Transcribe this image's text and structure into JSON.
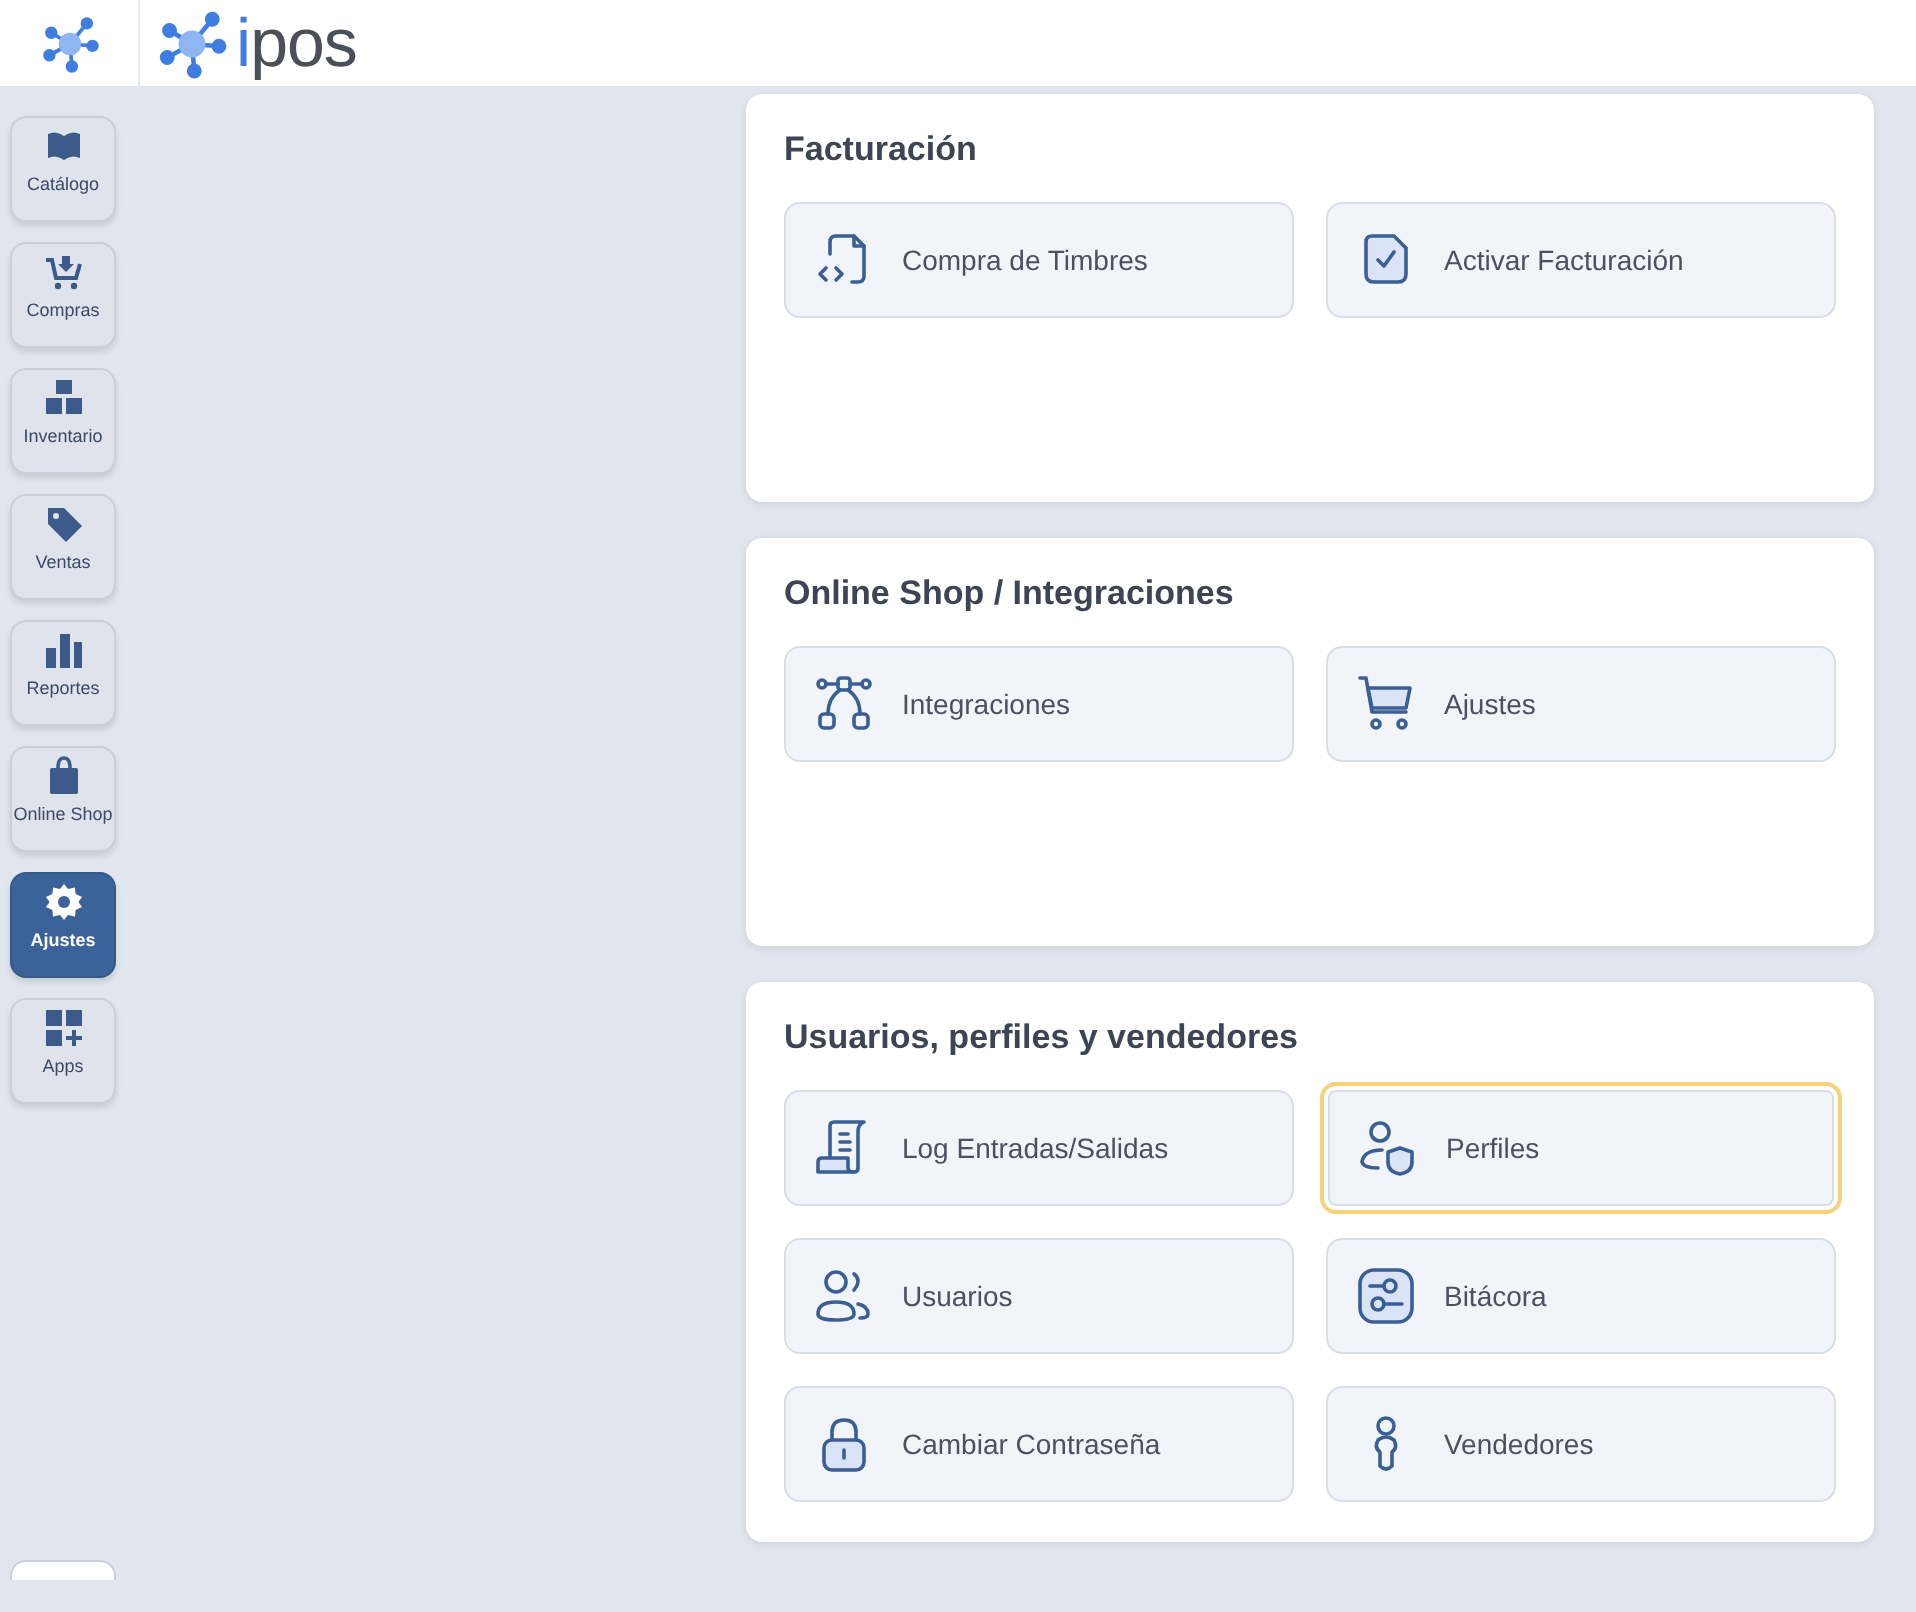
{
  "brand": "ipos",
  "sidebar": [
    {
      "label": "Catálogo",
      "selected": false
    },
    {
      "label": "Compras",
      "selected": false
    },
    {
      "label": "Inventario",
      "selected": false
    },
    {
      "label": "Ventas",
      "selected": false
    },
    {
      "label": "Reportes",
      "selected": false
    },
    {
      "label": "Online Shop",
      "selected": false
    },
    {
      "label": "Ajustes",
      "selected": true
    },
    {
      "label": "Apps",
      "selected": false
    }
  ],
  "sections": [
    {
      "title": "Facturación",
      "items": [
        {
          "label": "Compra de Timbres",
          "highlighted": false
        },
        {
          "label": "Activar Facturación",
          "highlighted": false
        }
      ]
    },
    {
      "title": "Online Shop / Integraciones",
      "items": [
        {
          "label": "Integraciones",
          "highlighted": false
        },
        {
          "label": "Ajustes",
          "highlighted": false
        }
      ]
    },
    {
      "title": "Usuarios, perfiles y vendedores",
      "items": [
        {
          "label": "Log Entradas/Salidas",
          "highlighted": false
        },
        {
          "label": "Perfiles",
          "highlighted": true
        },
        {
          "label": "Usuarios",
          "highlighted": false
        },
        {
          "label": "Bitácora",
          "highlighted": false
        },
        {
          "label": "Cambiar Contraseña",
          "highlighted": false
        },
        {
          "label": "Vendedores",
          "highlighted": false
        }
      ]
    }
  ]
}
